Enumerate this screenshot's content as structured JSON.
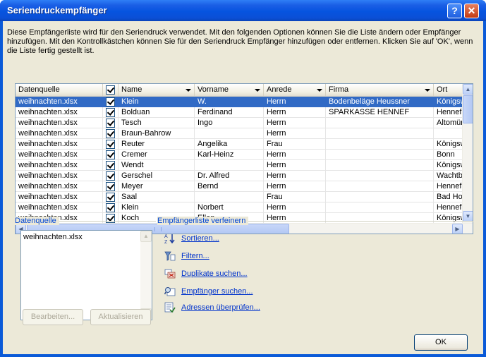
{
  "window": {
    "title": "Seriendruckempfänger"
  },
  "description": "Diese Empfängerliste wird für den Seriendruck verwendet. Mit den folgenden Optionen können Sie die Liste ändern oder Empfänger hinzufügen. Mit den Kontrollkästchen können Sie für den Seriendruck Empfänger hinzufügen oder entfernen. Klicken Sie auf 'OK', wenn die Liste fertig gestellt ist.",
  "table": {
    "columns": [
      "Datenquelle",
      "",
      "Name",
      "Vorname",
      "Anrede",
      "Firma",
      "Ort"
    ],
    "rows": [
      {
        "src": "weihnachten.xlsx",
        "name": "Klein",
        "vorname": "W.",
        "anrede": "Herrn",
        "firma": "Bodenbeläge Heussner",
        "ort": "Königswinter",
        "selected": true
      },
      {
        "src": "weihnachten.xlsx",
        "name": "Bolduan",
        "vorname": "Ferdinand",
        "anrede": "Herrn",
        "firma": "SPARKASSE HENNEF",
        "ort": "Hennef"
      },
      {
        "src": "weihnachten.xlsx",
        "name": "Tesch",
        "vorname": "Ingo",
        "anrede": "Herrn",
        "firma": "",
        "ort": "Altomünster"
      },
      {
        "src": "weihnachten.xlsx",
        "name": "Braun-Bahrow",
        "vorname": "",
        "anrede": "Herrn",
        "firma": "",
        "ort": ""
      },
      {
        "src": "weihnachten.xlsx",
        "name": "Reuter",
        "vorname": "Angelika",
        "anrede": "Frau",
        "firma": "",
        "ort": "Königswinter"
      },
      {
        "src": "weihnachten.xlsx",
        "name": "Cremer",
        "vorname": "Karl-Heinz",
        "anrede": "Herrn",
        "firma": "",
        "ort": "Bonn"
      },
      {
        "src": "weihnachten.xlsx",
        "name": "Wendt",
        "vorname": "",
        "anrede": "Herrn",
        "firma": "",
        "ort": "Königswinter"
      },
      {
        "src": "weihnachten.xlsx",
        "name": "Gerschel",
        "vorname": "Dr. Alfred",
        "anrede": "Herrn",
        "firma": "",
        "ort": "Wachtberg"
      },
      {
        "src": "weihnachten.xlsx",
        "name": "Meyer",
        "vorname": "Bernd",
        "anrede": "Herrn",
        "firma": "",
        "ort": "Hennef"
      },
      {
        "src": "weihnachten.xlsx",
        "name": "Saal",
        "vorname": "",
        "anrede": "Frau",
        "firma": "",
        "ort": "Bad Honnef"
      },
      {
        "src": "weihnachten.xlsx",
        "name": "Klein",
        "vorname": "Norbert",
        "anrede": "Herrn",
        "firma": "",
        "ort": "Hennef"
      },
      {
        "src": "weihnachten.xlsx",
        "name": "Koch",
        "vorname": "Ellen",
        "anrede": "Herrn",
        "firma": "",
        "ort": "Königswinter"
      }
    ]
  },
  "datasource": {
    "label": "Datenquelle",
    "items": [
      "weihnachten.xlsx"
    ],
    "edit_button": "Bearbeiten...",
    "refresh_button": "Aktualisieren"
  },
  "refine": {
    "label": "Empfängerliste verfeinern",
    "links": [
      {
        "label": "Sortieren...",
        "icon": "sort-az-icon"
      },
      {
        "label": "Filtern...",
        "icon": "filter-icon"
      },
      {
        "label": "Duplikate suchen...",
        "icon": "duplicates-icon"
      },
      {
        "label": "Empfänger suchen...",
        "icon": "find-recipient-icon"
      },
      {
        "label": "Adressen überprüfen...",
        "icon": "validate-addresses-icon"
      }
    ]
  },
  "ok_button": "OK",
  "colors": {
    "title_bar": "#0654df",
    "selection": "#316ac5",
    "link": "#0033cc",
    "group_label": "#0046d5",
    "dialog_bg": "#ece9d8"
  }
}
